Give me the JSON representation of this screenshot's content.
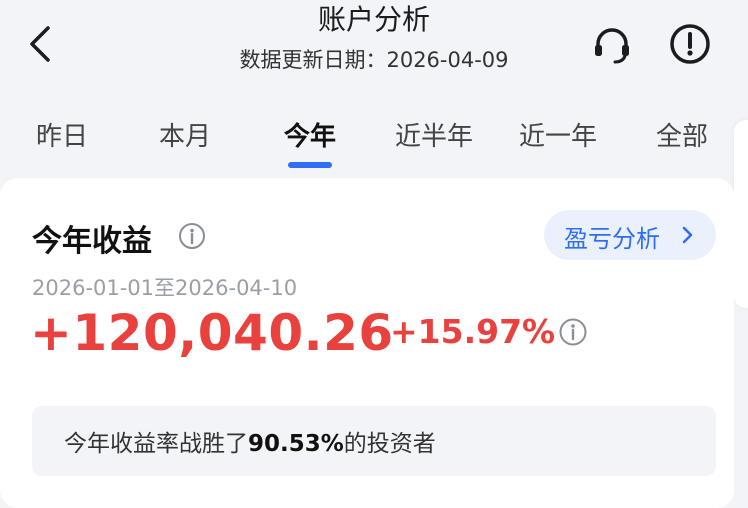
{
  "header": {
    "title": "账户分析",
    "subtitle": "数据更新日期：2026-04-09",
    "back_icon": "chevron-left-icon",
    "support_icon": "headset-icon",
    "alert_icon": "exclamation-circle-icon"
  },
  "tabs": [
    {
      "label": "昨日",
      "active": false
    },
    {
      "label": "本月",
      "active": false
    },
    {
      "label": "今年",
      "active": true
    },
    {
      "label": "近半年",
      "active": false
    },
    {
      "label": "近一年",
      "active": false
    },
    {
      "label": "全部",
      "active": false
    }
  ],
  "card": {
    "title": "今年收益",
    "analysis_button": "盈亏分析",
    "date_range": "2026-01-01至2026-04-10",
    "amount": "+120,040.26",
    "percent": "+15.97%",
    "beat": {
      "prefix": "今年收益率战胜了",
      "value": "90.53%",
      "suffix": "的投资者"
    }
  },
  "colors": {
    "accent": "#2f6ef5",
    "gain": "#e8413e",
    "background": "#f2f4f8"
  }
}
